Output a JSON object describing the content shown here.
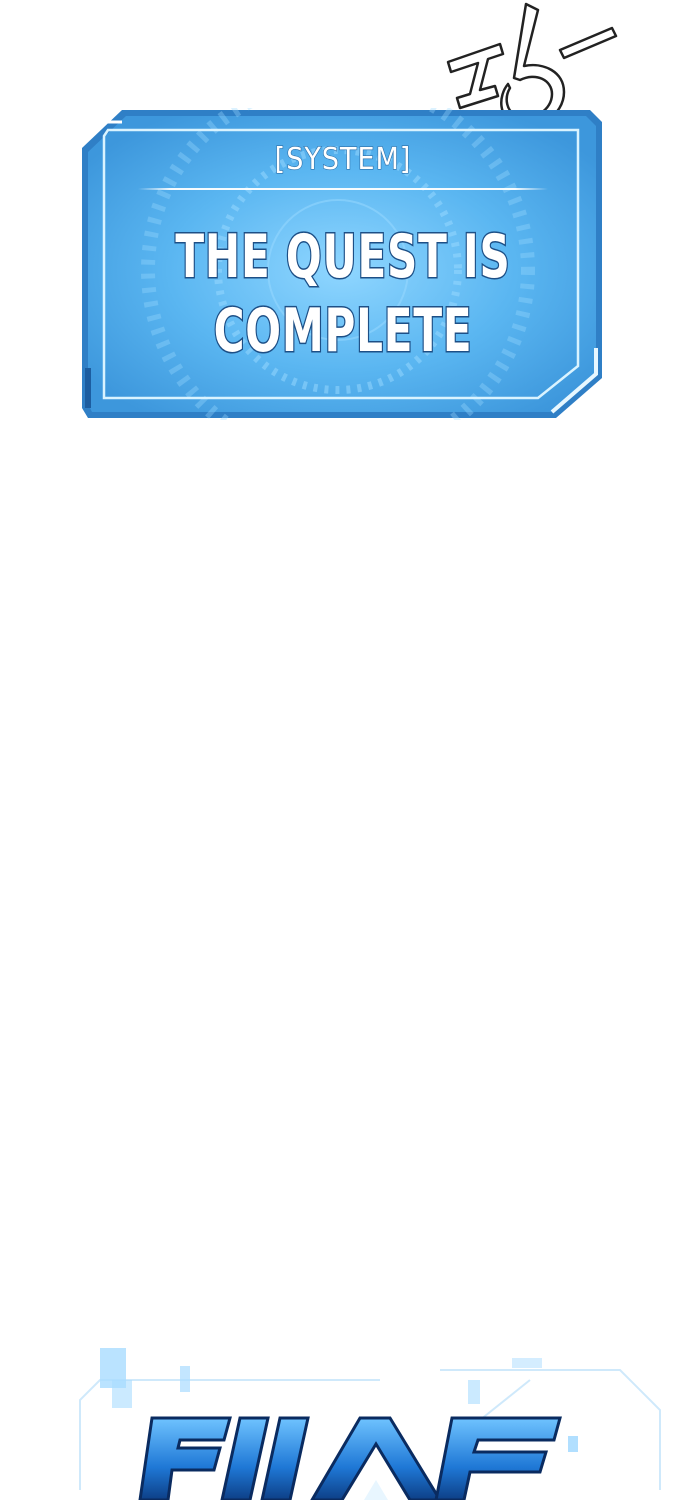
{
  "panel": {
    "header": "[SYSTEM]",
    "message": "THE QUEST IS COMPLETE"
  },
  "colors": {
    "panel_fill": "#5cb8f2",
    "panel_border": "#c8ecff",
    "text_outline": "#1d4f86",
    "logo_blue": "#1f78d6"
  },
  "icons": {
    "sfx": "handwritten-sound-effect",
    "logo": "title-logo-fragment"
  }
}
